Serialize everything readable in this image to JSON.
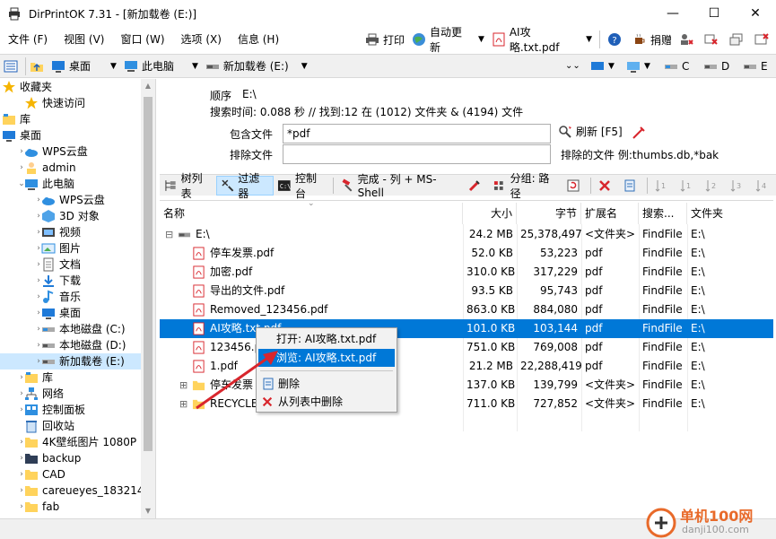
{
  "window": {
    "title": "DirPrintOK 7.31 - [新加载卷 (E:)]"
  },
  "menu": [
    "文件 (F)",
    "视图 (V)",
    "窗口 (W)",
    "选项 (X)",
    "信息 (H)"
  ],
  "menu_right": {
    "print": "打印",
    "auto_update": "自动更新",
    "current_file": "AI攻略.txt.pdf",
    "donate": "捐赠"
  },
  "address": {
    "desktop": "桌面",
    "this_pc": "此电脑",
    "volume": "新加载卷 (E:)"
  },
  "drives": [
    "C",
    "D",
    "E"
  ],
  "sidebar": {
    "items": [
      {
        "label": "收藏夹"
      },
      {
        "label": "快速访问"
      },
      {
        "label": "库"
      },
      {
        "label": "桌面"
      },
      {
        "label": "WPS云盘"
      },
      {
        "label": "admin"
      },
      {
        "label": "此电脑"
      },
      {
        "label": "WPS云盘"
      },
      {
        "label": "3D 对象"
      },
      {
        "label": "视频"
      },
      {
        "label": "图片"
      },
      {
        "label": "文档"
      },
      {
        "label": "下载"
      },
      {
        "label": "音乐"
      },
      {
        "label": "桌面"
      },
      {
        "label": "本地磁盘 (C:)"
      },
      {
        "label": "本地磁盘 (D:)"
      },
      {
        "label": "新加载卷 (E:)"
      },
      {
        "label": "库"
      },
      {
        "label": "网络"
      },
      {
        "label": "控制面板"
      },
      {
        "label": "回收站"
      },
      {
        "label": "4K壁纸图片 1080P"
      },
      {
        "label": "backup"
      },
      {
        "label": "CAD"
      },
      {
        "label": "careueyes_183214"
      },
      {
        "label": "fab"
      }
    ]
  },
  "info": {
    "order_label": "顺序",
    "order_value": "E:\\",
    "search_time": "搜索时间: 0.088 秒 //  找到:12 在 (1012) 文件夹 & (4194) 文件",
    "include_label": "包含文件",
    "include_value": "*pdf",
    "refresh": "刷新 [F5]",
    "exclude_label": "排除文件",
    "exclude_value": "",
    "exclude_hint": "排除的文件 例:thumbs.db,*bak"
  },
  "toolbar2": {
    "tree": "树列表",
    "filter": "过滤器",
    "console": "控制台",
    "done": "完成 - 列 + MS-Shell",
    "group": "分组: 路径"
  },
  "table": {
    "headers": {
      "name": "名称",
      "size": "大小",
      "bytes": "字节",
      "ext": "扩展名",
      "search": "搜索...",
      "folder": "文件夹"
    },
    "rows": [
      {
        "name": "E:\\",
        "size": "24.2 MB",
        "bytes": "25,378,497",
        "ext": "<文件夹>",
        "search": "FindFile",
        "folder": "E:\\"
      },
      {
        "name": "停车发票.pdf",
        "size": "52.0 KB",
        "bytes": "53,223",
        "ext": "pdf",
        "search": "FindFile",
        "folder": "E:\\"
      },
      {
        "name": "加密.pdf",
        "size": "310.0 KB",
        "bytes": "317,229",
        "ext": "pdf",
        "search": "FindFile",
        "folder": "E:\\"
      },
      {
        "name": "导出的文件.pdf",
        "size": "93.5 KB",
        "bytes": "95,743",
        "ext": "pdf",
        "search": "FindFile",
        "folder": "E:\\"
      },
      {
        "name": "Removed_123456.pdf",
        "size": "863.0 KB",
        "bytes": "884,080",
        "ext": "pdf",
        "search": "FindFile",
        "folder": "E:\\"
      },
      {
        "name": "AI攻略.txt.pdf",
        "size": "101.0 KB",
        "bytes": "103,144",
        "ext": "pdf",
        "search": "FindFile",
        "folder": "E:\\"
      },
      {
        "name": "123456.pdf",
        "size": "751.0 KB",
        "bytes": "769,008",
        "ext": "pdf",
        "search": "FindFile",
        "folder": "E:\\"
      },
      {
        "name": "1.pdf",
        "size": "21.2 MB",
        "bytes": "22,288,419",
        "ext": "pdf",
        "search": "FindFile",
        "folder": "E:\\"
      },
      {
        "name": "停车发票",
        "size": "137.0 KB",
        "bytes": "139,799",
        "ext": "<文件夹>",
        "search": "FindFile",
        "folder": "E:\\"
      },
      {
        "name": "RECYCLE",
        "size": "711.0 KB",
        "bytes": "727,852",
        "ext": "<文件夹>",
        "search": "FindFile",
        "folder": "E:\\"
      }
    ]
  },
  "context_menu": {
    "open": "打开: AI攻略.txt.pdf",
    "browse": "浏览: AI攻略.txt.pdf",
    "delete": "删除",
    "remove": "从列表中删除"
  },
  "watermark": {
    "cn": "单机100网",
    "url": "danji100.com"
  },
  "colors": {
    "selection": "#0078d7",
    "pdf_red": "#d8262d",
    "folder_yellow": "#ffd35c"
  }
}
